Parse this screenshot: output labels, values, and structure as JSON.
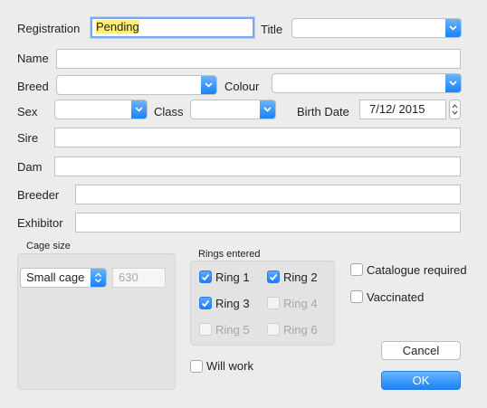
{
  "form": {
    "registration_label": "Registration",
    "registration_value": "Pending",
    "title_label": "Title",
    "title_value": "",
    "name_label": "Name",
    "name_value": "",
    "breed_label": "Breed",
    "breed_value": "",
    "colour_label": "Colour",
    "colour_value": "",
    "sex_label": "Sex",
    "sex_value": "",
    "class_label": "Class",
    "class_value": "",
    "birth_date_label": "Birth Date",
    "birth_date_value": "7/12/ 2015",
    "sire_label": "Sire",
    "sire_value": "",
    "dam_label": "Dam",
    "dam_value": "",
    "breeder_label": "Breeder",
    "breeder_value": "",
    "exhibitor_label": "Exhibitor",
    "exhibitor_value": ""
  },
  "cage": {
    "label": "Cage size",
    "selected": "Small cage",
    "size_value": "630"
  },
  "rings": {
    "label": "Rings entered",
    "items": [
      {
        "label": "Ring 1",
        "checked": true,
        "enabled": true
      },
      {
        "label": "Ring 2",
        "checked": true,
        "enabled": true
      },
      {
        "label": "Ring 3",
        "checked": true,
        "enabled": true
      },
      {
        "label": "Ring 4",
        "checked": false,
        "enabled": false
      },
      {
        "label": "Ring 5",
        "checked": false,
        "enabled": false
      },
      {
        "label": "Ring 6",
        "checked": false,
        "enabled": false
      }
    ]
  },
  "options": {
    "catalogue_label": "Catalogue required",
    "catalogue_checked": false,
    "vaccinated_label": "Vaccinated",
    "vaccinated_checked": false,
    "will_work_label": "Will work",
    "will_work_checked": false
  },
  "buttons": {
    "cancel": "Cancel",
    "ok": "OK"
  },
  "colors": {
    "accent": "#1a82fb",
    "highlight": "#ffee7a",
    "background": "#ececec"
  }
}
